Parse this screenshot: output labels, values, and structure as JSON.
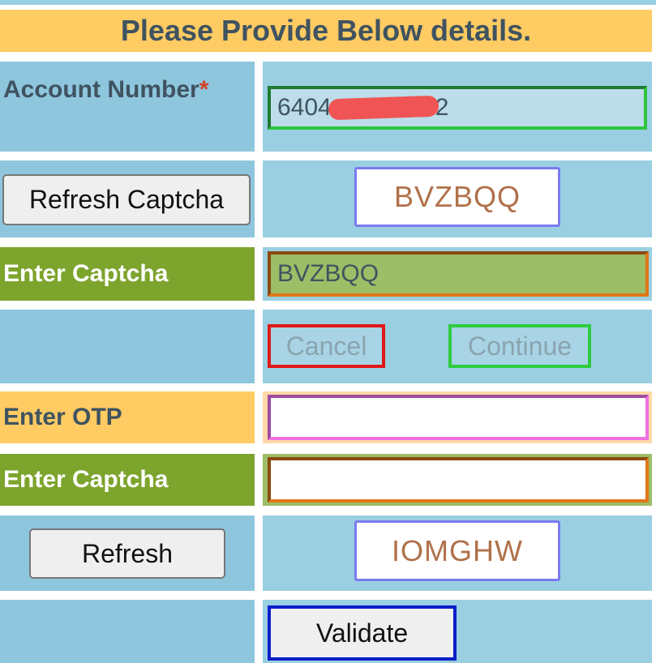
{
  "header": {
    "title": "Please Provide Below details."
  },
  "account": {
    "label": "Account Number",
    "required_mark": "*",
    "value_start": "6404",
    "value_end": "2"
  },
  "captcha1": {
    "refresh_label": "Refresh Captcha",
    "image_text": "BVZBQQ",
    "input_label": "Enter Captcha",
    "input_value": "BVZBQQ"
  },
  "actions": {
    "cancel_label": "Cancel",
    "continue_label": "Continue"
  },
  "otp": {
    "label": "Enter OTP",
    "value": ""
  },
  "captcha2": {
    "input_label": "Enter Captcha",
    "input_value": "",
    "refresh_label": "Refresh",
    "image_text": "IOMGHW"
  },
  "validate": {
    "label": "Validate"
  },
  "colors": {
    "background": "#8ec6de",
    "header": "#ffcb63",
    "green_label": "#7da42d",
    "orange_label": "#ffcb63"
  }
}
